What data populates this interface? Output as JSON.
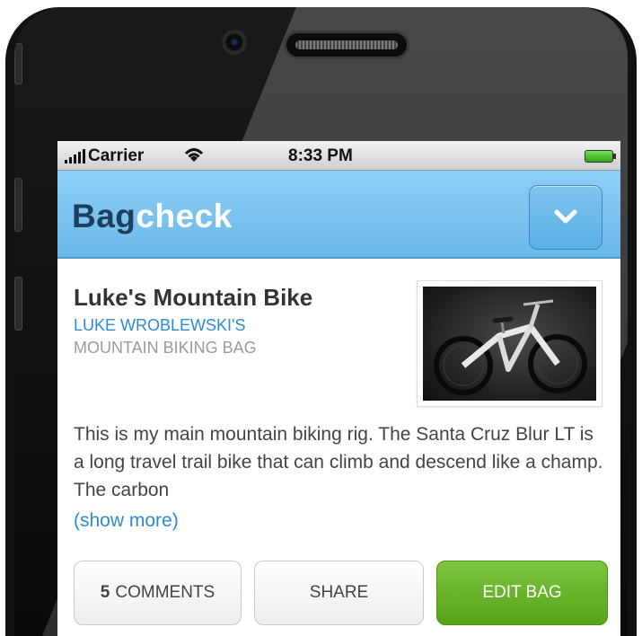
{
  "status_bar": {
    "carrier": "Carrier",
    "time": "8:33 PM"
  },
  "header": {
    "logo_part1": "Bag",
    "logo_part2": "check",
    "menu_icon": "chevron-down-icon"
  },
  "bag": {
    "title": "Luke's Mountain Bike",
    "owner": "LUKE WROBLEWSKI'S",
    "type": "MOUNTAIN BIKING BAG",
    "description": "This is my main mountain biking rig. The Santa Cruz Blur LT is a long travel trail bike that can climb and descend like a champ. The carbon",
    "show_more": "(show more)",
    "image_icon": "mountain-bike-photo"
  },
  "actions": {
    "comments_count": "5",
    "comments_label": "COMMENTS",
    "share_label": "SHARE",
    "edit_label": "EDIT BAG"
  },
  "colors": {
    "header_blue": "#6bb8ea",
    "logo_dark": "#1d3e5e",
    "link_blue": "#2c8ad6",
    "edit_green": "#56a418"
  }
}
